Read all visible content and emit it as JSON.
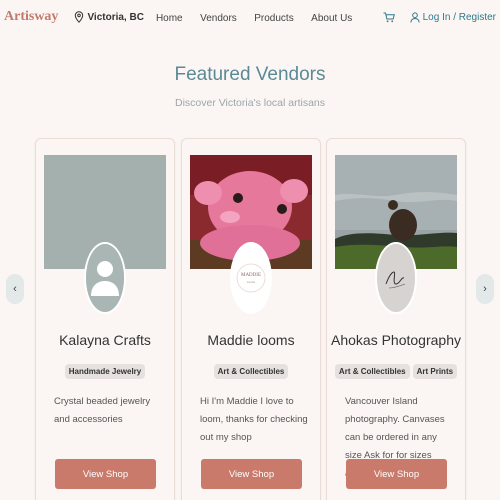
{
  "header": {
    "logo": "Artisway",
    "location": "Victoria, BC",
    "nav": [
      "Home",
      "Vendors",
      "Products",
      "About Us"
    ],
    "login": "Log In / Register"
  },
  "section": {
    "title": "Featured Vendors",
    "subtitle": "Discover Victoria's local artisans"
  },
  "arrows": {
    "prev": "‹",
    "next": "›"
  },
  "vendors": [
    {
      "name": "Kalayna Crafts",
      "tags": [
        "Handmade Jewelry"
      ],
      "description": "Crystal beaded jewelry and accessories",
      "button": "View Shop"
    },
    {
      "name": "Maddie looms",
      "tags": [
        "Art & Collectibles"
      ],
      "description": "Hi I'm Maddie I love to loom, thanks for checking out my shop",
      "button": "View Shop",
      "avatar_text": "MADDIE"
    },
    {
      "name": "Ahokas Photography",
      "tags": [
        "Art & Collectibles",
        "Art Prints"
      ],
      "description": "Vancouver Island photography. Canvases can be ordered in any size Ask for for sizes and...",
      "button": "View Shop"
    }
  ],
  "colors": {
    "background": "#fbf6f3",
    "brand": "#c47a6c",
    "accent_teal": "#5a8a96",
    "button": "#c97a6b"
  }
}
